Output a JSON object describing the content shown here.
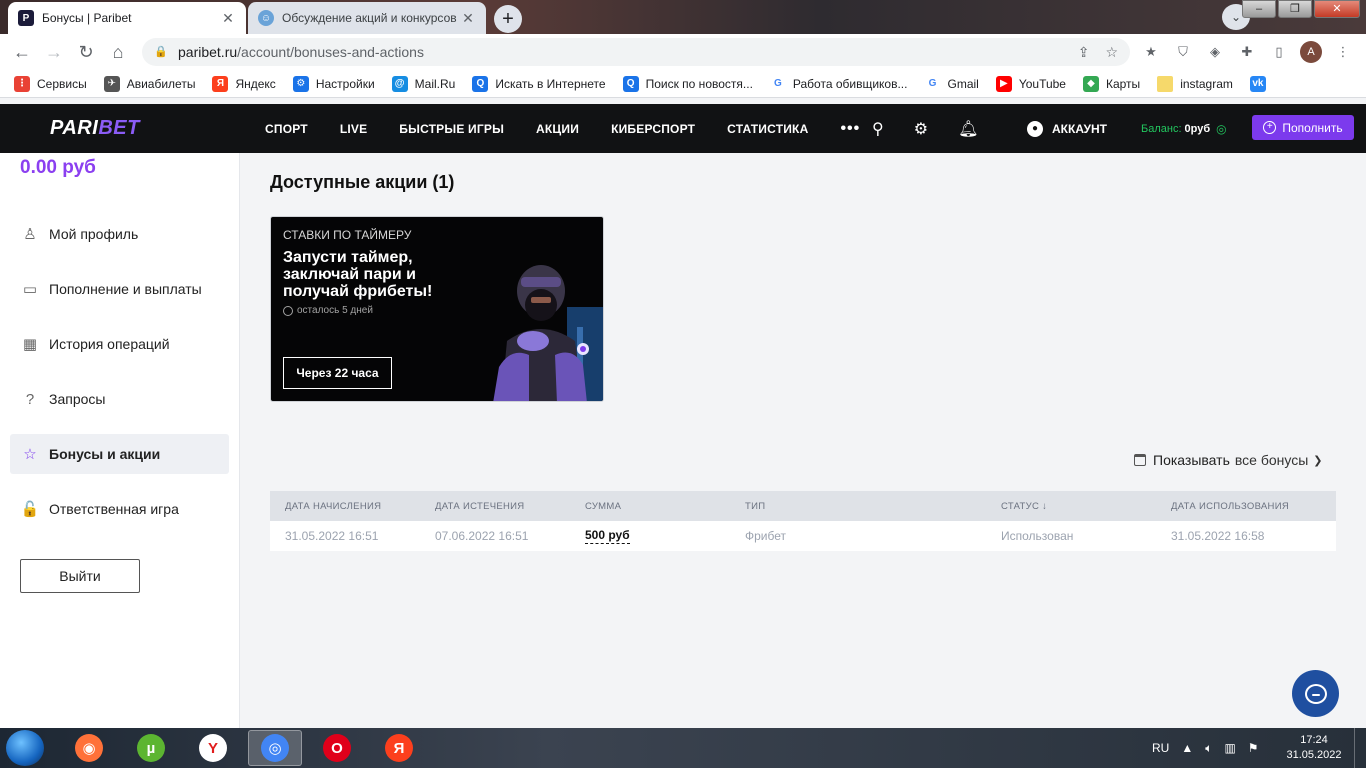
{
  "browser": {
    "tabs": [
      {
        "title": "Бонусы | Paribet",
        "favicon": "P",
        "active": true
      },
      {
        "title": "Обсуждение акций и конкурсов",
        "favicon": "☺",
        "active": false
      }
    ],
    "new_tab": "+",
    "url_host": "paribet.ru",
    "url_path": "/account/bonuses-and-actions",
    "profile_initial": "A",
    "bookmarks": [
      {
        "label": "Сервисы",
        "icon": "apps-grid-icon",
        "color": "#e94235",
        "glyph": "⋮"
      },
      {
        "label": "Авиабилеты",
        "icon": "globe-icon",
        "color": "#555555",
        "glyph": "✈"
      },
      {
        "label": "Яндекс",
        "icon": "yandex-icon",
        "color": "#fc3f1d",
        "glyph": "Я"
      },
      {
        "label": "Настройки",
        "icon": "gear-icon",
        "color": "#1a73e8",
        "glyph": "⚙"
      },
      {
        "label": "Mail.Ru",
        "icon": "mailru-icon",
        "color": "#168de2",
        "glyph": "@"
      },
      {
        "label": "Искать в Интернете",
        "icon": "search-icon",
        "color": "#1a73e8",
        "glyph": "Q"
      },
      {
        "label": "Поиск по новостя...",
        "icon": "search-icon",
        "color": "#1a73e8",
        "glyph": "Q"
      },
      {
        "label": "Работа обивщиков...",
        "icon": "google-icon",
        "color": "#ffffff",
        "glyph": "G"
      },
      {
        "label": "Gmail",
        "icon": "google-icon",
        "color": "#ffffff",
        "glyph": "G"
      },
      {
        "label": "YouTube",
        "icon": "youtube-icon",
        "color": "#ff0000",
        "glyph": "▶"
      },
      {
        "label": "Карты",
        "icon": "maps-icon",
        "color": "#34a853",
        "glyph": "◆"
      },
      {
        "label": "instagram",
        "icon": "folder-icon",
        "color": "#f6d96b",
        "glyph": ""
      },
      {
        "label": "",
        "icon": "vk-icon",
        "color": "#2787f5",
        "glyph": "vk"
      }
    ]
  },
  "header": {
    "logo_a": "PARI",
    "logo_b": "BET",
    "nav": [
      "СПОРТ",
      "LIVE",
      "БЫСТРЫЕ ИГРЫ",
      "АКЦИИ",
      "КИБЕРСПОРТ",
      "СТАТИСТИКА"
    ],
    "more": "•••",
    "account_label": "АККАУНТ",
    "balance_label": "Баланс:",
    "balance_value": "0руб",
    "deposit_label": "Пополнить"
  },
  "sidebar": {
    "balance": "0.00 руб",
    "items": [
      {
        "label": "Мой профиль",
        "icon": "user-icon",
        "glyph": "♙",
        "active": false
      },
      {
        "label": "Пополнение и выплаты",
        "icon": "wallet-icon",
        "glyph": "▭",
        "active": false
      },
      {
        "label": "История операций",
        "icon": "grid-icon",
        "glyph": "▦",
        "active": false
      },
      {
        "label": "Запросы",
        "icon": "question-icon",
        "glyph": "?",
        "active": false
      },
      {
        "label": "Бонусы и акции",
        "icon": "star-icon",
        "glyph": "☆",
        "active": true
      },
      {
        "label": "Ответственная игра",
        "icon": "lock-icon",
        "glyph": "🔓",
        "active": false
      }
    ],
    "logout": "Выйти"
  },
  "main": {
    "title": "Доступные акции (1)",
    "promo": {
      "tag": "СТАВКИ ПО ТАЙМЕРУ",
      "title": "Запусти таймер, заключай пари и получай фрибеты!",
      "time_left": "осталось 5 дней",
      "button": "Через 22 часа"
    },
    "filter": {
      "label": "Показывать",
      "value": "все бонусы"
    },
    "table": {
      "columns": [
        "ДАТА НАЧИСЛЕНИЯ",
        "ДАТА ИСТЕЧЕНИЯ",
        "СУММА",
        "ТИП",
        "СТАТУС ↓",
        "ДАТА ИСПОЛЬЗОВАНИЯ"
      ],
      "rows": [
        [
          "31.05.2022 16:51",
          "07.06.2022 16:51",
          "500 руб",
          "Фрибет",
          "Использован",
          "31.05.2022 16:58"
        ]
      ]
    }
  },
  "taskbar": {
    "lang": "RU",
    "time": "17:24",
    "date": "31.05.2022",
    "apps": [
      {
        "name": "firefox-icon",
        "color": "#ff7139",
        "glyph": "◉"
      },
      {
        "name": "utorrent-icon",
        "color": "#5cb531",
        "glyph": "µ"
      },
      {
        "name": "yandex-browser-icon",
        "color": "#ffffff",
        "glyph": "Y"
      },
      {
        "name": "chrome-icon",
        "color": "#4285f4",
        "glyph": "◎"
      },
      {
        "name": "opera-icon",
        "color": "#e0001a",
        "glyph": "O"
      },
      {
        "name": "yandex-icon",
        "color": "#fc3f1d",
        "glyph": "Я"
      }
    ]
  },
  "colors": {
    "accent": "#7c3aed",
    "balance_green": "#22c55e",
    "header_bg": "#111214"
  }
}
